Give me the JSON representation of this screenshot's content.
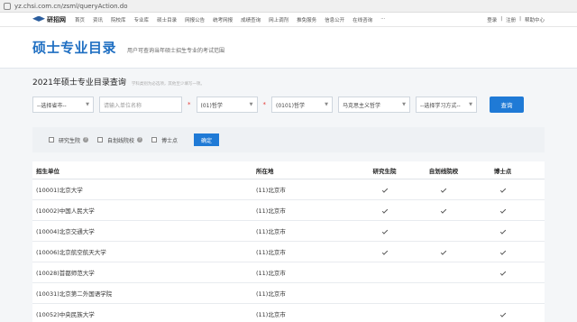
{
  "browser": {
    "url": "yz.chsi.com.cn/zsml/queryAction.do"
  },
  "site": {
    "name": "研招网"
  },
  "nav": {
    "items": [
      "首页",
      "资讯",
      "院校库",
      "专业库",
      "硕士目录",
      "网报公告",
      "统考网报",
      "成绩查询",
      "网上调剂",
      "推免服务",
      "信息公开",
      "在线咨询",
      "···"
    ],
    "right": [
      "登录",
      "|",
      "注册",
      "|",
      "帮助中心"
    ]
  },
  "hero": {
    "title": "硕士专业目录",
    "subtitle": "用户可查询当年硕士招生专业的考试范围"
  },
  "query": {
    "title": "2021年硕士专业目录查询",
    "hint": "学科类别为必选项，其他至少填写一项。",
    "province": "--选择省市--",
    "unit_placeholder": "请输入单位名称",
    "category": "(01)哲学",
    "discipline": "(0101)哲学",
    "major": "马克思主义哲学",
    "study_mode": "--选择学习方式--",
    "submit": "查询"
  },
  "checks": {
    "items": [
      {
        "label": "研究生院",
        "help": "?"
      },
      {
        "label": "自划线院校",
        "help": "?"
      },
      {
        "label": "博士点",
        "help": ""
      }
    ],
    "confirm": "确定"
  },
  "table": {
    "headers": [
      "招生单位",
      "所在地",
      "研究生院",
      "自划线院校",
      "博士点"
    ],
    "rows": [
      {
        "unit": "(10001)北京大学",
        "location": "(11)北京市",
        "grad_school": true,
        "self_line": true,
        "doctoral": true
      },
      {
        "unit": "(10002)中国人民大学",
        "location": "(11)北京市",
        "grad_school": true,
        "self_line": true,
        "doctoral": true
      },
      {
        "unit": "(10004)北京交通大学",
        "location": "(11)北京市",
        "grad_school": true,
        "self_line": false,
        "doctoral": true
      },
      {
        "unit": "(10006)北京航空航天大学",
        "location": "(11)北京市",
        "grad_school": true,
        "self_line": true,
        "doctoral": true
      },
      {
        "unit": "(10028)首都师范大学",
        "location": "(11)北京市",
        "grad_school": false,
        "self_line": false,
        "doctoral": true
      },
      {
        "unit": "(10031)北京第二外国语学院",
        "location": "(11)北京市",
        "grad_school": false,
        "self_line": false,
        "doctoral": false
      },
      {
        "unit": "(10052)中央民族大学",
        "location": "(11)北京市",
        "grad_school": false,
        "self_line": false,
        "doctoral": true
      }
    ]
  }
}
